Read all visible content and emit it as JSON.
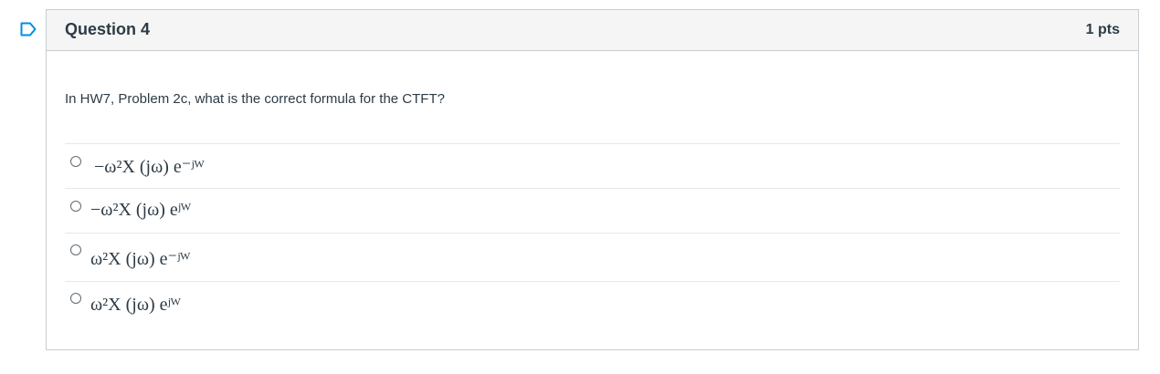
{
  "question": {
    "title": "Question 4",
    "points": "1 pts",
    "text": "In HW7, Problem 2c, what is the correct formula for the CTFT?"
  },
  "answers": [
    {
      "label": "−ω²X (jω) e⁻ʲᵂ"
    },
    {
      "label": "−ω²X (jω) eʲᵂ"
    },
    {
      "label": "ω²X (jω) e⁻ʲᵂ"
    },
    {
      "label": "ω²X (jω) eʲᵂ"
    }
  ],
  "icons": {
    "flag": "flag-question-icon"
  },
  "colors": {
    "accent": "#008ee2",
    "text": "#2d3b45",
    "border": "#c7cdd1",
    "header_bg": "#f5f5f5"
  }
}
